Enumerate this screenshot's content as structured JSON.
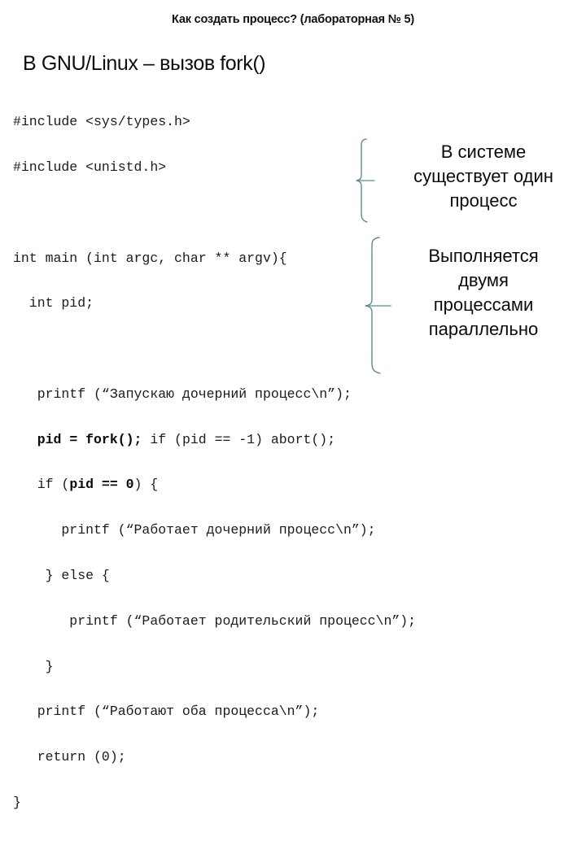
{
  "slide": {
    "title": "Как создать процесс? (лабораторная № 5)",
    "subtitle": "В GNU/Linux – вызов fork()",
    "background_color": "#ffffff",
    "text_color": "#0b0b0b",
    "bracket_color": "#5c8a93"
  },
  "code": {
    "language": "c",
    "line_01": "#include <sys/types.h>",
    "line_02": "#include <unistd.h>",
    "line_03": "",
    "line_04_a": "int main (int argc, char ** argv){",
    "line_05": "  int pid;",
    "line_06": "",
    "line_07": "   printf (“Запускаю дочерний процесс\\n”);",
    "line_08_a": "   ",
    "line_08_b": "pid = fork();",
    "line_08_c": " if (pid == -1) abort();",
    "line_09_a": "   if (",
    "line_09_b": "pid == 0",
    "line_09_c": ") {",
    "line_10": "      printf (“Работает дочерний процесс\\n”);",
    "line_11": "    } else {",
    "line_12": "       printf (“Работает родительский процесс\\n”);",
    "line_13": "    }",
    "line_14": "   printf (“Работают оба процесса\\n”);",
    "line_15": "   return (0);",
    "line_16": "}"
  },
  "annotations": {
    "callout_one": "В системе\nсуществует один\nпроцесс",
    "callout_two": "Выполняется\nдвумя\nпроцессами\nпараллельно"
  }
}
